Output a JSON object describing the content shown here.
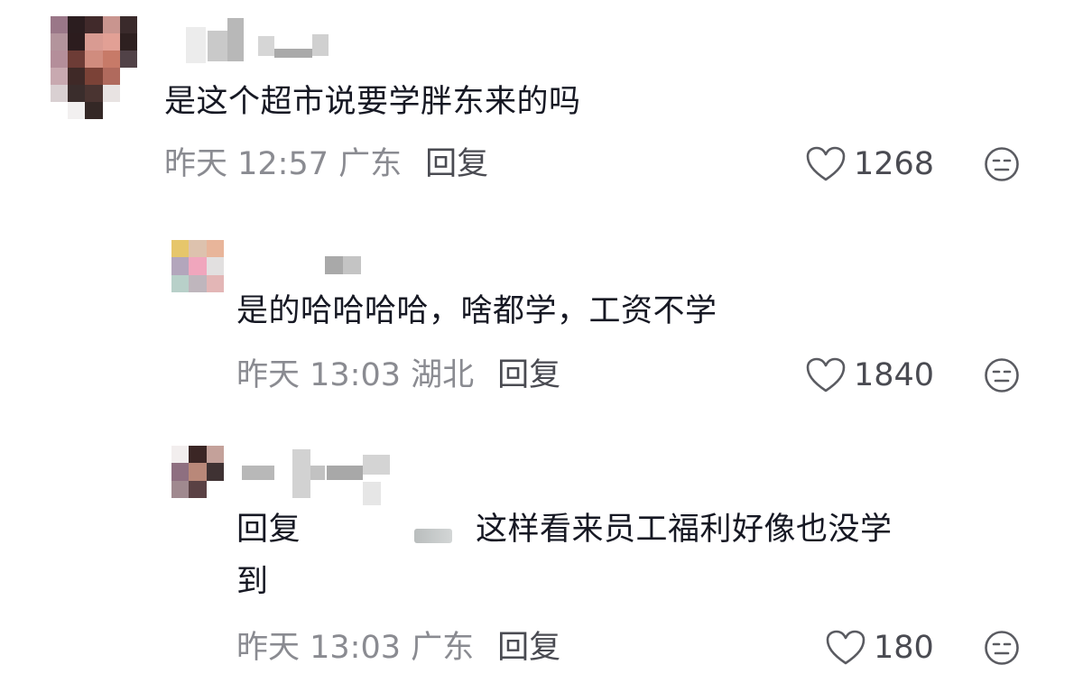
{
  "comments": [
    {
      "text": "是这个超市说要学胖东来的吗",
      "meta": "昨天 12:57 广东",
      "reply_label": "回复",
      "likes": "1268",
      "avatar_colors": [
        "#9a7788",
        "#2b1d1f",
        "#412a2b",
        "#c9958f",
        "#3a2a2b",
        "#b3949c",
        "#2c1c1e",
        "#d99b92",
        "#e2a095",
        "#2e2020",
        "#b48e9a",
        "#6d3c36",
        "#d08c7e",
        "#c77a68",
        "#514247",
        "#c8a9b0",
        "#3f2927",
        "#7b4237",
        "#b06a5d",
        "#ffffff",
        "#d9d0d2",
        "#3a2d2c",
        "#4a3431",
        "#e8e3e2",
        "#ffffff",
        "#ffffff",
        "#f2f0f0",
        "#342826",
        "#ffffff",
        "#ffffff"
      ],
      "username_colors": [
        "#e6e6e6",
        "#b5b5b5",
        "#c7c7c7",
        "#d9d9d9",
        "#a7a7a7",
        "#bfbfbf"
      ]
    },
    {
      "text": "是的哈哈哈哈，啥都学，工资不学",
      "meta": "昨天 13:03 湖北",
      "reply_label": "回复",
      "likes": "1840",
      "avatar_colors": [
        "#e6c66b",
        "#ddc2ae",
        "#e8b59a",
        "#b3a6bc",
        "#f0a6bd",
        "#e2e0e0",
        "#b8d0c9",
        "#bfb6bd",
        "#e3b6b6"
      ],
      "username_colors": [
        "#a9a9a9",
        "#c4c4c4"
      ]
    },
    {
      "reply_prefix": "回复",
      "text_line1": "这样看来员工福利好像也没学",
      "text_line2": "到",
      "meta": "昨天 13:03 广东",
      "reply_label": "回复",
      "likes": "180",
      "avatar_colors": [
        "#f2eeee",
        "#3b2625",
        "#c4a19a",
        "#8e6f80",
        "#b98879",
        "#3f3233",
        "#a0898f",
        "#5a4144",
        "#ffffff"
      ],
      "username_colors": [
        "#b8b8b8",
        "#a8a8a8",
        "#d4d4d4",
        "#c2c2c2"
      ]
    }
  ]
}
